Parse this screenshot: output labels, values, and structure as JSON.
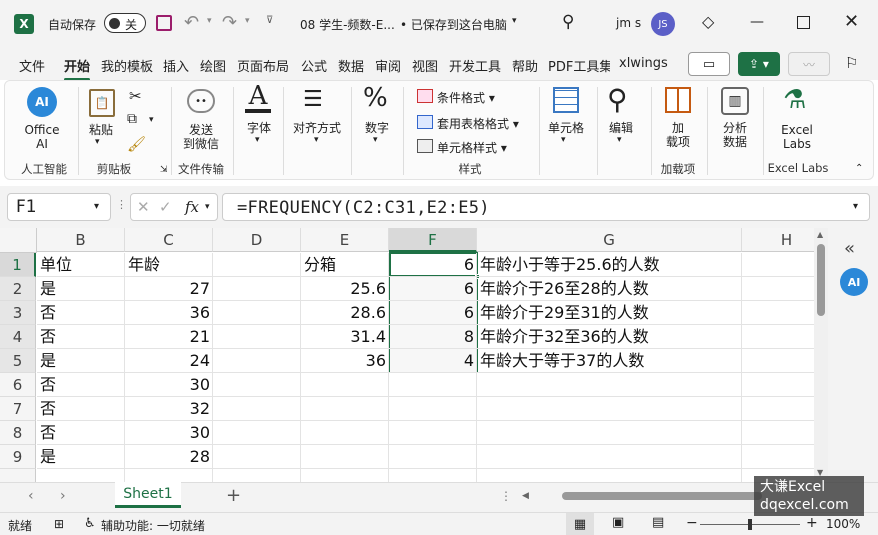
{
  "title": {
    "autosave": "自动保存",
    "toggle": "关",
    "filename": "08 学生-频数-E...",
    "saved": "• 已保存到这台电脑",
    "user": "jm s",
    "avatar": "JS"
  },
  "tabs": [
    "文件",
    "开始",
    "我的模板",
    "插入",
    "绘图",
    "页面布局",
    "公式",
    "数据",
    "审阅",
    "视图",
    "开发工具",
    "帮助",
    "PDF工具集",
    "xlwings"
  ],
  "ribbon": {
    "office_ai": [
      "Office",
      "AI"
    ],
    "paste": "粘贴",
    "send": [
      "发送",
      "到微信"
    ],
    "font": "字体",
    "align": "对齐方式",
    "number": "数字",
    "cond": "条件格式",
    "tablefmt": "套用表格格式",
    "cellstyle": "单元格样式",
    "cells": "单元格",
    "edit": "编辑",
    "addin": [
      "加",
      "载项"
    ],
    "analyze": [
      "分析",
      "数据"
    ],
    "labs": [
      "Excel",
      "Labs"
    ],
    "groups": {
      "ai": "人工智能",
      "clipboard": "剪贴板",
      "filetransfer": "文件传输",
      "styles": "样式",
      "addins": "加载项",
      "labs": "Excel Labs"
    }
  },
  "formula": {
    "namebox": "F1",
    "fx": "fx",
    "content": "=FREQUENCY(C2:C31,E2:E5)"
  },
  "columns": [
    "B",
    "C",
    "D",
    "E",
    "F",
    "G",
    "H"
  ],
  "rows": [
    {
      "n": "1",
      "b": "单位",
      "c": "年龄",
      "e": "分箱",
      "f": "6",
      "g": "年龄小于等于25.6的人数"
    },
    {
      "n": "2",
      "b": "是",
      "c": "27",
      "e": "25.6",
      "f": "6",
      "g": "年龄介于26至28的人数"
    },
    {
      "n": "3",
      "b": "否",
      "c": "36",
      "e": "28.6",
      "f": "6",
      "g": "年龄介于29至31的人数"
    },
    {
      "n": "4",
      "b": "否",
      "c": "21",
      "e": "31.4",
      "f": "8",
      "g": "年龄介于32至36的人数"
    },
    {
      "n": "5",
      "b": "是",
      "c": "24",
      "e": "36",
      "f": "4",
      "g": "年龄大于等于37的人数"
    },
    {
      "n": "6",
      "b": "否",
      "c": "30",
      "e": "",
      "f": "",
      "g": ""
    },
    {
      "n": "7",
      "b": "否",
      "c": "32",
      "e": "",
      "f": "",
      "g": ""
    },
    {
      "n": "8",
      "b": "否",
      "c": "30",
      "e": "",
      "f": "",
      "g": ""
    },
    {
      "n": "9",
      "b": "是",
      "c": "28",
      "e": "",
      "f": "",
      "g": ""
    }
  ],
  "sheet": {
    "name": "Sheet1"
  },
  "status": {
    "ready": "就绪",
    "access": "辅助功能: 一切就绪",
    "zoom": "100%"
  },
  "watermark": {
    "line1": "大谦Excel",
    "line2": "dqexcel.com"
  },
  "accent": "#1e7145"
}
